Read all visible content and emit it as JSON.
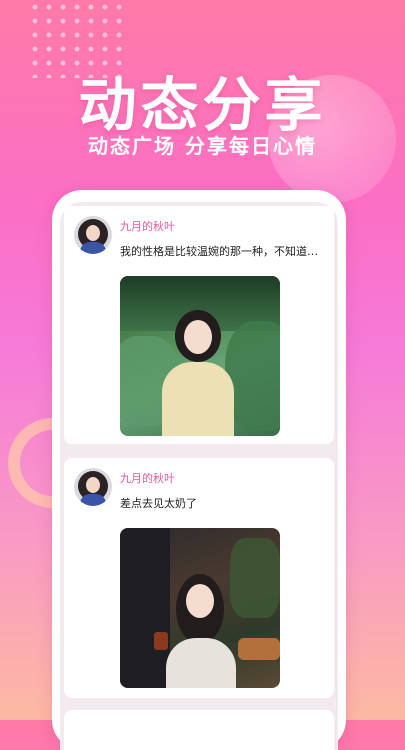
{
  "hero": {
    "title": "动态分享",
    "subtitle": "动态广场 分享每日心情"
  },
  "feed": {
    "posts": [
      {
        "username": "九月的秋叶",
        "content": "我的性格是比较温婉的那一种，不知道…",
        "image_icon": "photo-woman-garden"
      },
      {
        "username": "九月的秋叶",
        "content": "差点去见太奶了",
        "image_icon": "photo-woman-cafe"
      }
    ]
  },
  "colors": {
    "username": "#e45aa0",
    "background_top": "#ff7aa8",
    "background_bottom": "#fdb9a3"
  }
}
